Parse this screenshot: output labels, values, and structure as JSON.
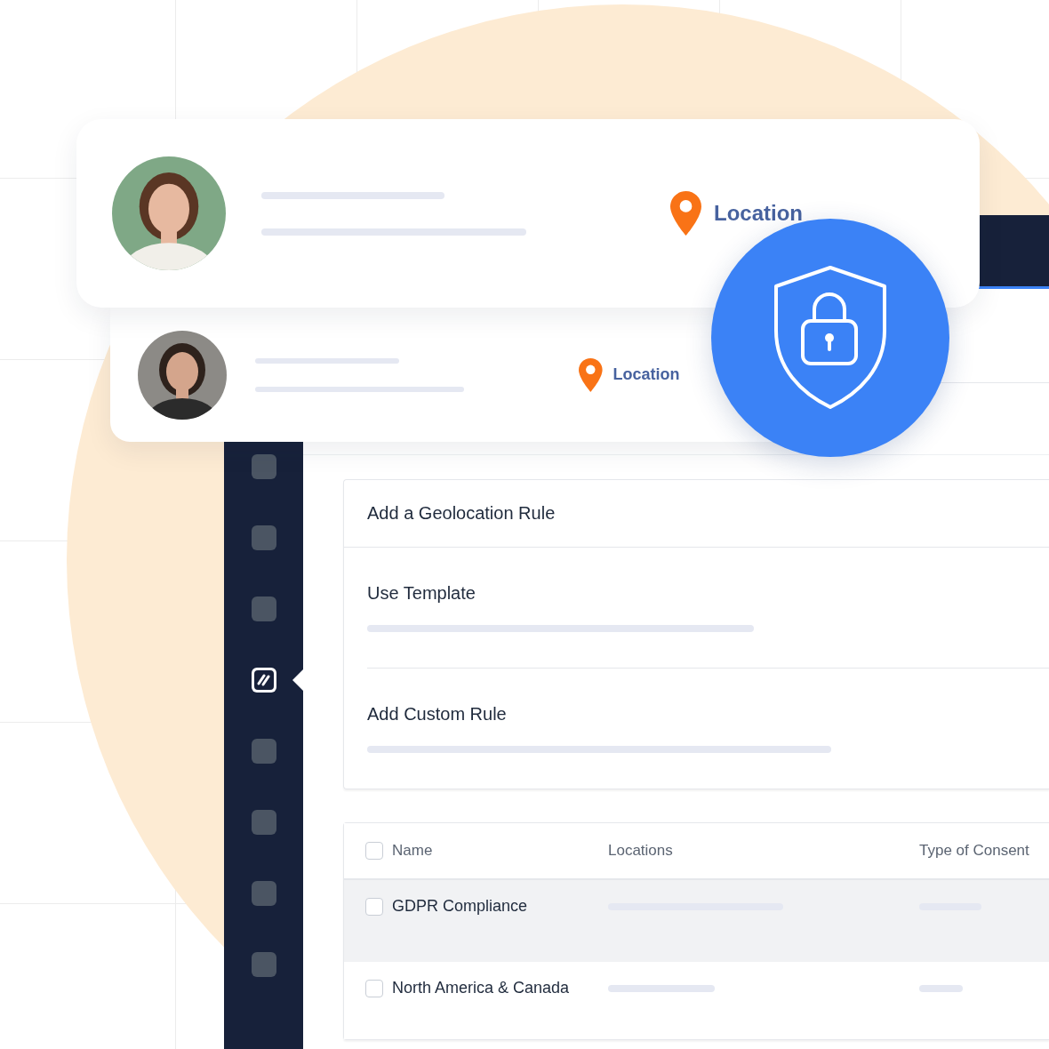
{
  "profiles": [
    {
      "kind": "large",
      "location": "Location"
    },
    {
      "kind": "small",
      "location": "Location"
    }
  ],
  "sidebar": {
    "items": [
      {
        "selected": false
      },
      {
        "selected": false
      },
      {
        "selected": false
      },
      {
        "selected": true
      },
      {
        "selected": false
      },
      {
        "selected": false
      },
      {
        "selected": false
      },
      {
        "selected": false
      }
    ]
  },
  "rule_panel": {
    "title": "Add a Geolocation Rule",
    "options": [
      {
        "label": "Use Template"
      },
      {
        "label": "Add Custom Rule"
      }
    ]
  },
  "table": {
    "columns": [
      "Name",
      "Locations",
      "Type of Consent"
    ],
    "header_checked": false,
    "rows": [
      {
        "name": "GDPR Compliance",
        "checked": false,
        "selected": true
      },
      {
        "name": "North America & Canada",
        "checked": false,
        "selected": false
      }
    ]
  }
}
